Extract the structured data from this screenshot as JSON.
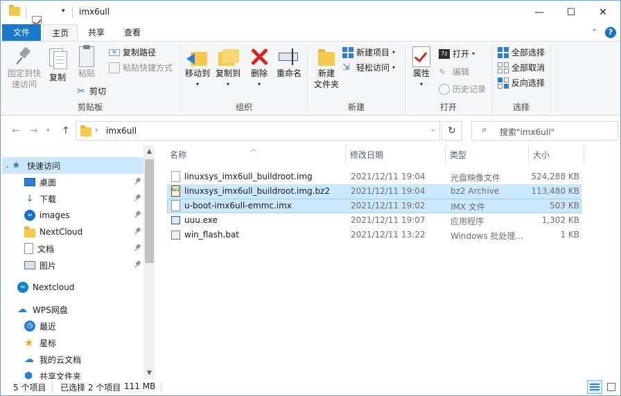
{
  "window": {
    "title": "imx6ull",
    "minimize": "—",
    "maximize": "☐",
    "close": "✕"
  },
  "ribbon_tabs": {
    "file": "文件",
    "home": "主页",
    "share": "共享",
    "view": "查看",
    "expand": "⌃",
    "help": "?"
  },
  "ribbon": {
    "clipboard": {
      "label": "剪贴板",
      "pin_quick_access": [
        "固定到快",
        "速访问"
      ],
      "copy": "复制",
      "paste": "粘贴",
      "copy_path": "复制路径",
      "paste_shortcut": "粘贴快捷方式",
      "cut": "剪切"
    },
    "organize": {
      "label": "组织",
      "move_to": "移动到",
      "copy_to": "复制到",
      "delete": "删除",
      "rename": "重命名"
    },
    "new": {
      "label": "新建",
      "new_folder": [
        "新建",
        "文件夹"
      ],
      "new_item": "新建项目",
      "easy_access": "轻松访问"
    },
    "open": {
      "label": "打开",
      "properties": "属性",
      "open": "打开",
      "edit": "编辑",
      "history": "历史记录"
    },
    "select": {
      "label": "选择",
      "select_all": "全部选择",
      "select_none": "全部取消",
      "invert": "反向选择"
    }
  },
  "address": {
    "path": "imx6ull",
    "search_placeholder": "搜索\"imx6ull\""
  },
  "nav_pane": {
    "items": [
      {
        "label": "快速访问",
        "icon": "star-icon",
        "pinned": false
      },
      {
        "label": "桌面",
        "icon": "desktop-icon",
        "pinned": true
      },
      {
        "label": "下载",
        "icon": "download-icon",
        "pinned": true
      },
      {
        "label": "images",
        "icon": "images-icon",
        "pinned": true
      },
      {
        "label": "NextCloud",
        "icon": "folder-icon",
        "pinned": true
      },
      {
        "label": "文档",
        "icon": "document-icon",
        "pinned": true
      },
      {
        "label": "图片",
        "icon": "pictures-icon",
        "pinned": true
      },
      {
        "label": "Nextcloud",
        "icon": "nextcloud-icon",
        "pinned": false
      },
      {
        "label": "WPS网盘",
        "icon": "cloud-icon",
        "pinned": false
      },
      {
        "label": "最近",
        "icon": "clock-icon",
        "pinned": false
      },
      {
        "label": "星标",
        "icon": "star-gold-icon",
        "pinned": false
      },
      {
        "label": "我的云文档",
        "icon": "cloud-doc-icon",
        "pinned": false
      },
      {
        "label": "共享文件夹",
        "icon": "shared-folder-icon",
        "pinned": false
      }
    ]
  },
  "columns": {
    "name": "名称",
    "date": "修改日期",
    "type": "类型",
    "size": "大小"
  },
  "files": [
    {
      "name": "linuxsys_imx6ull_buildroot.img",
      "date": "2021/12/11 19:04",
      "type": "光盘映像文件",
      "size": "524,288 KB",
      "icon": "disc-image-icon",
      "icon_text": ""
    },
    {
      "name": "linuxsys_imx6ull_buildroot.img.bz2",
      "date": "2021/12/11 19:04",
      "type": "bz2 Archive",
      "size": "113,480 KB",
      "icon": "bz2-archive-icon",
      "icon_text": "bz2"
    },
    {
      "name": "u-boot-imx6ull-emmc.imx",
      "date": "2021/12/11 19:02",
      "type": "IMX 文件",
      "size": "503 KB",
      "icon": "file-icon",
      "icon_text": ""
    },
    {
      "name": "uuu.exe",
      "date": "2021/12/11 19:07",
      "type": "应用程序",
      "size": "1,302 KB",
      "icon": "exe-icon",
      "icon_text": ""
    },
    {
      "name": "win_flash.bat",
      "date": "2021/12/11 13:22",
      "type": "Windows 批处理...",
      "size": "1 KB",
      "icon": "bat-icon",
      "icon_text": ""
    }
  ],
  "status": {
    "count": "5 个项目",
    "selected": "已选择 2 个项目",
    "size": "111 MB"
  }
}
